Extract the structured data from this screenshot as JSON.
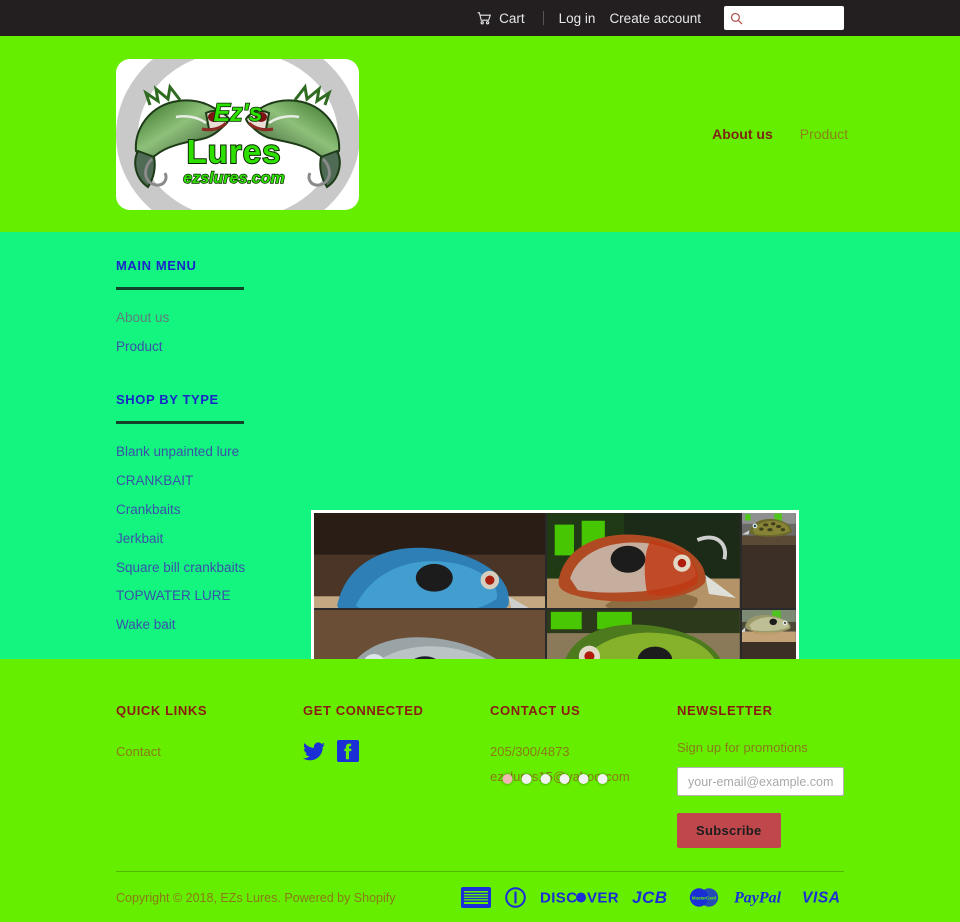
{
  "topbar": {
    "cart_label": "Cart",
    "cart_icon": "shopping-cart-icon",
    "login_label": "Log in",
    "create_account_label": "Create account",
    "search_icon": "search-icon",
    "search_value": "",
    "search_placeholder": ""
  },
  "header": {
    "logo": {
      "name": "ezs-lures-logo",
      "brand_line1": "Ez's",
      "brand_line2": "Lures",
      "brand_line3": "ezslures.com"
    },
    "nav": [
      {
        "label": "About us",
        "state": "active"
      },
      {
        "label": "Product",
        "state": "normal"
      }
    ]
  },
  "sidebar": {
    "main_menu": {
      "heading": "MAIN MENU",
      "items": [
        {
          "label": "About us"
        },
        {
          "label": "Product"
        }
      ]
    },
    "shop_by_type": {
      "heading": "SHOP BY TYPE",
      "items": [
        {
          "label": "Blank unpainted lure"
        },
        {
          "label": "CRANKBAIT"
        },
        {
          "label": "Crankbaits"
        },
        {
          "label": "Jerkbait"
        },
        {
          "label": "Square bill crankbaits"
        },
        {
          "label": "TOPWATER LURE"
        },
        {
          "label": "Wake bait"
        }
      ]
    }
  },
  "carousel": {
    "name": "homepage-image-slideshow",
    "slide_count": 6,
    "active_slide": 1,
    "alt": "Collage of hand-painted bluegill crankbait fishing lures"
  },
  "footer": {
    "quick_links": {
      "heading": "QUICK LINKS",
      "items": [
        {
          "label": "Contact"
        }
      ]
    },
    "get_connected": {
      "heading": "GET CONNECTED",
      "social": [
        {
          "name": "twitter-icon",
          "label": "Twitter"
        },
        {
          "name": "facebook-icon",
          "label": "Facebook"
        }
      ]
    },
    "contact_us": {
      "heading": "CONTACT US",
      "phone": "205/300/4873",
      "email": "ezslures15@yahoo.com"
    },
    "newsletter": {
      "heading": "NEWSLETTER",
      "note": "Sign up for promotions",
      "email_value": "",
      "email_placeholder": "your-email@example.com",
      "subscribe_label": "Subscribe"
    },
    "copyright": "Copyright © 2018, EZs Lures. Powered by Shopify",
    "payments": [
      {
        "name": "amex-icon",
        "label": "American Express"
      },
      {
        "name": "diners-club-icon",
        "label": "Diners Club"
      },
      {
        "name": "discover-icon",
        "label": "DISCOVER"
      },
      {
        "name": "jcb-icon",
        "label": "JCB"
      },
      {
        "name": "mastercard-icon",
        "label": "MasterCard"
      },
      {
        "name": "paypal-icon",
        "label": "PayPal"
      },
      {
        "name": "visa-icon",
        "label": "VISA"
      }
    ]
  },
  "colors": {
    "topbar_bg": "#231f20",
    "header_bg": "#66ee00",
    "body_bg": "#13f57f",
    "footer_bg": "#66ee00",
    "nav_active": "#7d2610",
    "nav_normal": "#8a8417",
    "sidebar_heading": "#1a27c8",
    "footer_heading": "#8a1d10",
    "footer_link": "#8a7a16",
    "subscribe_bg": "#c0484c",
    "payment_icon": "#1a2fd6"
  }
}
